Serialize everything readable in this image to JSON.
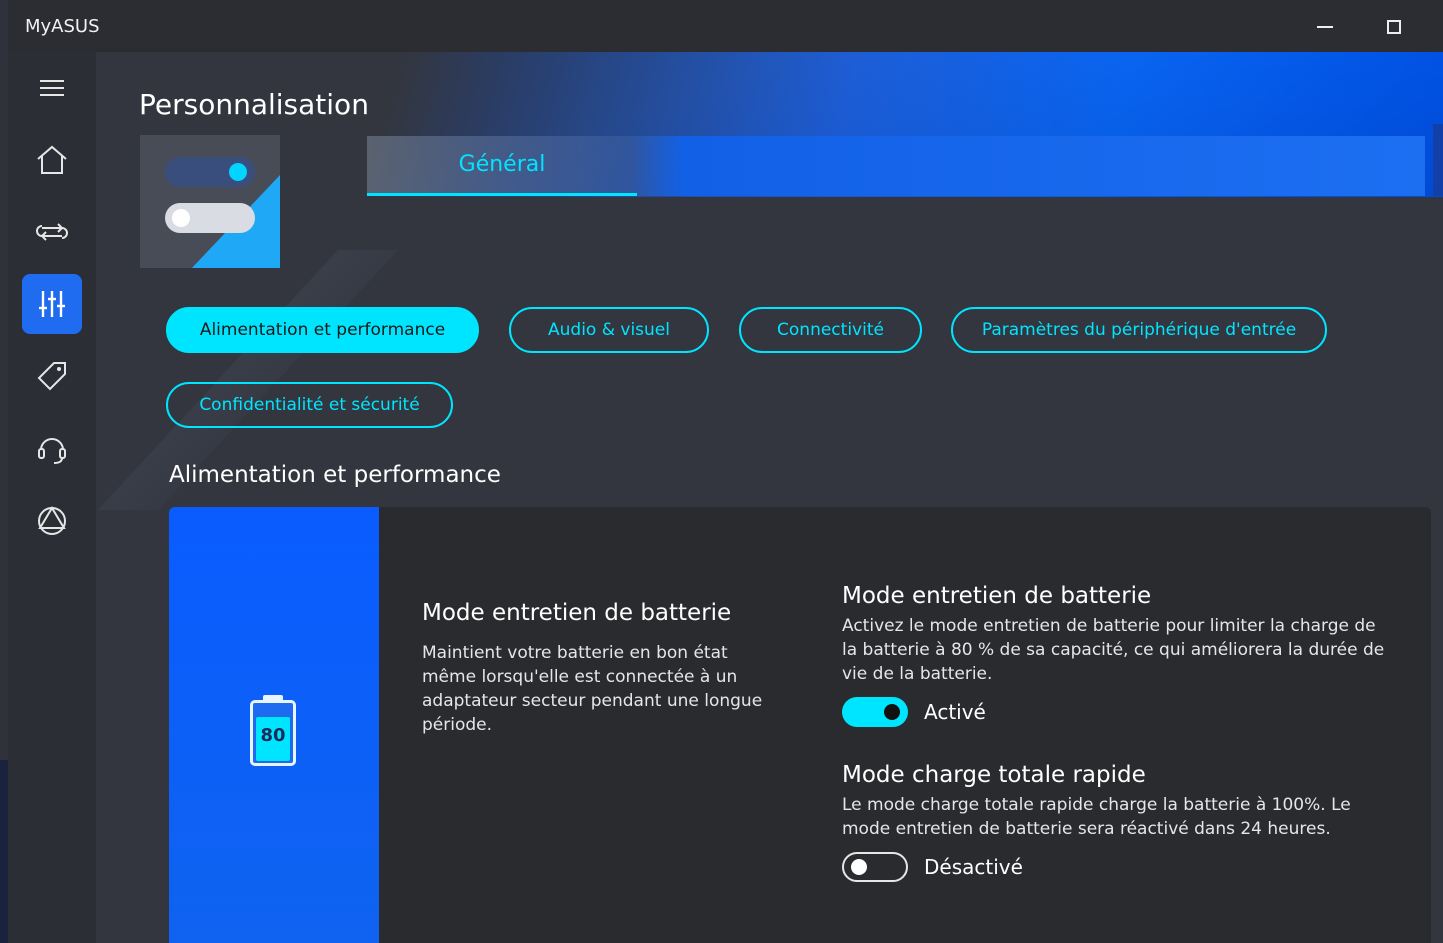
{
  "app": {
    "title": "MyASUS"
  },
  "page": {
    "title": "Personnalisation"
  },
  "tabs": [
    {
      "label": "Général"
    }
  ],
  "categories": [
    {
      "label": "Alimentation et performance"
    },
    {
      "label": "Audio & visuel"
    },
    {
      "label": "Connectivité"
    },
    {
      "label": "Paramètres du périphérique d'entrée"
    },
    {
      "label": "Confidentialité et sécurité"
    }
  ],
  "section": {
    "title": "Alimentation et performance"
  },
  "card": {
    "battery_level": "80",
    "intro_title": "Mode entretien de batterie",
    "intro_text": "Maintient votre batterie en bon état même lorsqu'elle est connectée à un adaptateur secteur pendant une longue période.",
    "settings": [
      {
        "title": "Mode entretien de batterie",
        "description": "Activez le mode entretien de batterie pour limiter la charge de la batterie à 80 % de sa capacité, ce qui améliorera la durée de vie de la batterie.",
        "state_label": "Activé"
      },
      {
        "title": "Mode charge totale rapide",
        "description": "Le mode charge totale rapide charge la batterie à 100%. Le mode entretien de batterie sera réactivé dans 24 heures.",
        "state_label": "Désactivé"
      }
    ]
  },
  "colors": {
    "accent": "#00e5ff",
    "brand_blue": "#0a5cff",
    "background": "#33363e"
  }
}
